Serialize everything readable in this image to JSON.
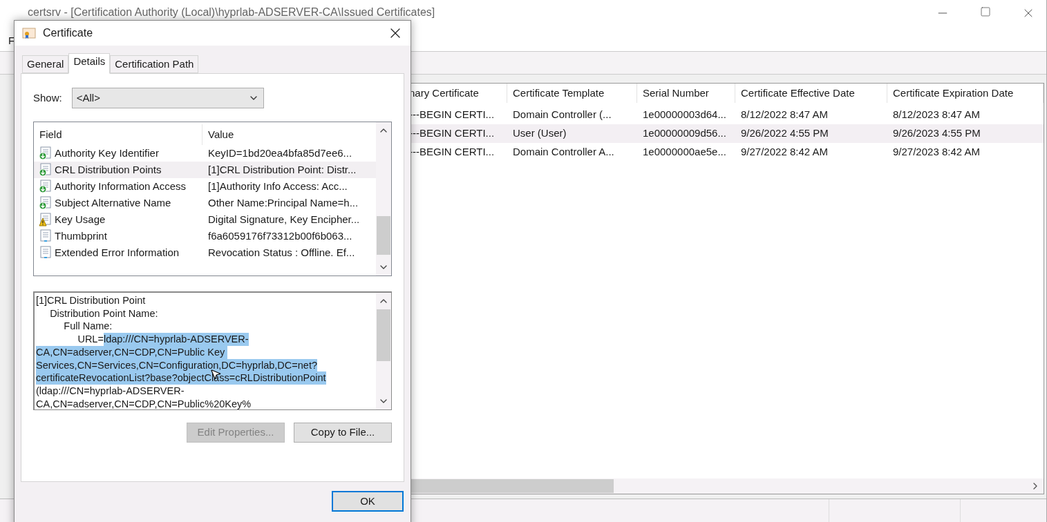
{
  "main_window": {
    "title": "certsrv - [Certification Authority (Local)\\hyprlab-ADSERVER-CA\\Issued Certificates]",
    "menu": [
      "F"
    ],
    "table": {
      "columns": [
        "nary Certificate",
        "Certificate Template",
        "Serial Number",
        "Certificate Effective Date",
        "Certificate Expiration Date"
      ],
      "rows": [
        {
          "cells": [
            "---BEGIN CERTI...",
            "Domain Controller (...",
            "1e00000003d64...",
            "8/12/2022 8:47 AM",
            "8/12/2023 8:47 AM"
          ],
          "selected": false
        },
        {
          "cells": [
            "---BEGIN CERTI...",
            "User (User)",
            "1e00000009d56...",
            "9/26/2022 4:55 PM",
            "9/26/2023 4:55 PM"
          ],
          "selected": true
        },
        {
          "cells": [
            "---BEGIN CERTI...",
            "Domain Controller A...",
            "1e0000000ae5e...",
            "9/27/2022 8:42 AM",
            "9/27/2023 8:42 AM"
          ],
          "selected": false
        }
      ]
    }
  },
  "dialog": {
    "title": "Certificate",
    "tabs": [
      {
        "label": "General",
        "selected": false
      },
      {
        "label": "Details",
        "selected": true
      },
      {
        "label": "Certification Path",
        "selected": false
      }
    ],
    "show": {
      "label": "Show:",
      "value": "<All>"
    },
    "fields": {
      "columns": [
        "Field",
        "Value"
      ],
      "rows": [
        {
          "kind": "extension",
          "field": "Authority Key Identifier",
          "value": "KeyID=1bd20ea4bfa85d7ee6...",
          "selected": false
        },
        {
          "kind": "extension",
          "field": "CRL Distribution Points",
          "value": "[1]CRL Distribution Point: Distr...",
          "selected": true
        },
        {
          "kind": "extension",
          "field": "Authority Information Access",
          "value": "[1]Authority Info Access: Acc...",
          "selected": false
        },
        {
          "kind": "extension",
          "field": "Subject Alternative Name",
          "value": "Other Name:Principal Name=h...",
          "selected": false
        },
        {
          "kind": "critical",
          "field": "Key Usage",
          "value": "Digital Signature, Key Encipher...",
          "selected": false
        },
        {
          "kind": "property",
          "field": "Thumbprint",
          "value": "f6a6059176f73312b00f6b063...",
          "selected": false
        },
        {
          "kind": "property",
          "field": "Extended Error Information",
          "value": "Revocation Status : Offline. Ef...",
          "selected": false
        }
      ]
    },
    "details_text": [
      [
        {
          "text": "[1]CRL Distribution Point",
          "selected": false
        }
      ],
      [
        {
          "text": "     Distribution Point Name:",
          "selected": false
        }
      ],
      [
        {
          "text": "          Full Name:",
          "selected": false
        }
      ],
      [
        {
          "text": "               URL=",
          "selected": false
        },
        {
          "text": "ldap:///CN=hyprlab-ADSERVER-",
          "selected": true
        }
      ],
      [
        {
          "text": "CA,CN=adserver,CN=CDP,CN=Public Key ",
          "selected": true
        }
      ],
      [
        {
          "text": "Services,CN=Services,CN=Configuration,DC=hyprlab,DC=net?",
          "selected": true
        }
      ],
      [
        {
          "text": "certificateRevocationList?base?objectClass=cRLDistributionPoint",
          "selected": true
        }
      ],
      [
        {
          "text": "(ldap:///CN=hyprlab-ADSERVER-",
          "selected": false
        }
      ],
      [
        {
          "text": "CA,CN=adserver,CN=CDP,CN=Public%20Key%",
          "selected": false
        }
      ]
    ],
    "buttons": [
      {
        "label": "Edit Properties...",
        "disabled": true
      },
      {
        "label": "Copy to File...",
        "disabled": false
      }
    ],
    "ok": "OK"
  }
}
